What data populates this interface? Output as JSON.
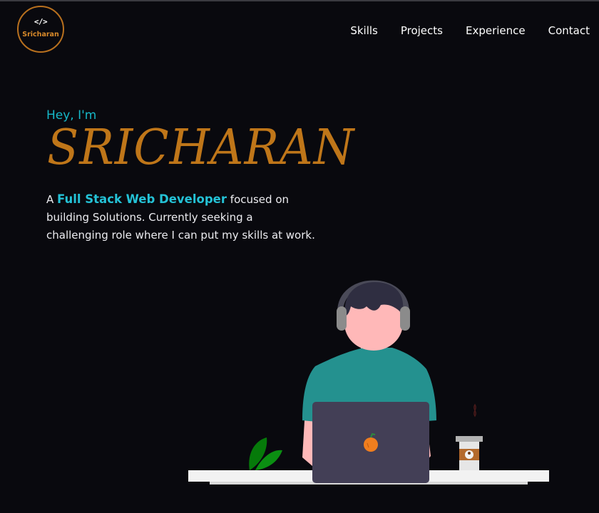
{
  "logo": {
    "glyph": "</>",
    "name": "Sricharan"
  },
  "nav": {
    "items": [
      {
        "label": "Skills"
      },
      {
        "label": "Projects"
      },
      {
        "label": "Experience"
      },
      {
        "label": "Contact"
      }
    ]
  },
  "hero": {
    "greeting": "Hey, I'm",
    "name": "SRICHARAN",
    "intro_prefix": "A ",
    "intro_highlight": "Full Stack Web Developer",
    "intro_rest": " focused on building Solutions. Currently seeking a challenging role where I can put my skills at work."
  },
  "colors": {
    "background": "#09090e",
    "accent_orange": "#bf7619",
    "accent_cyan": "#24c2d6",
    "shirt": "#24918f",
    "laptop": "#433f56",
    "skin": "#ffb8b8"
  },
  "icons": {
    "logo": "code-brackets-icon"
  }
}
